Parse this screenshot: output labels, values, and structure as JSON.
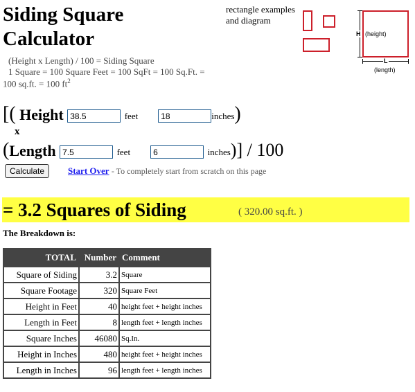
{
  "header": {
    "title_line1": "Siding Square",
    "title_line2": "Calculator",
    "formula_line1": "(Height x Length) / 100 = Siding Square",
    "formula_line2": "1 Square = 100 Square Feet = 100 SqFt = 100 Sq.Ft. =",
    "formula_line3": "100 sq.ft. = 100 ft",
    "formula_sup": "2"
  },
  "diagram": {
    "label_line1": "rectangle examples",
    "label_line2": "and diagram",
    "h_label": "H",
    "height_label": "(height)",
    "l_label": "L",
    "length_label": "(length)",
    "accent_color": "#cc1f2a"
  },
  "form": {
    "open_brackets": "[(",
    "height_label": "Height",
    "height_feet": "38.5",
    "height_inches": "18",
    "feet_unit": "feet",
    "inches_unit": "inches",
    "close_paren": ")",
    "multiply": "x",
    "open_paren": "(",
    "length_label": "Length",
    "length_feet": "7.5",
    "length_inches": "6",
    "close_tail": ")] / 100",
    "calculate_label": "Calculate",
    "start_over_label": "Start Over",
    "start_over_note": "- To completely start from scratch on this page"
  },
  "result": {
    "main": "= 3.2 Squares of Siding",
    "sub": "( 320.00 sq.ft. )",
    "highlight_color": "#ffff44"
  },
  "breakdown": {
    "heading": "The Breakdown is:",
    "columns": [
      "TOTAL",
      "Number",
      "Comment"
    ],
    "rows": [
      {
        "label": "Square of Siding",
        "number": "3.2",
        "comment": "Square"
      },
      {
        "label": "Square Footage",
        "number": "320",
        "comment": "Square Feet"
      },
      {
        "label": "Height in Feet",
        "number": "40",
        "comment": "height feet + height inches"
      },
      {
        "label": "Length in Feet",
        "number": "8",
        "comment": "length feet + length inches"
      },
      {
        "label": "Square Inches",
        "number": "46080",
        "comment": "Sq.In."
      },
      {
        "label": "Height in Inches",
        "number": "480",
        "comment": "height feet + height inches"
      },
      {
        "label": "Length in Inches",
        "number": "96",
        "comment": "length feet + length inches"
      }
    ]
  }
}
